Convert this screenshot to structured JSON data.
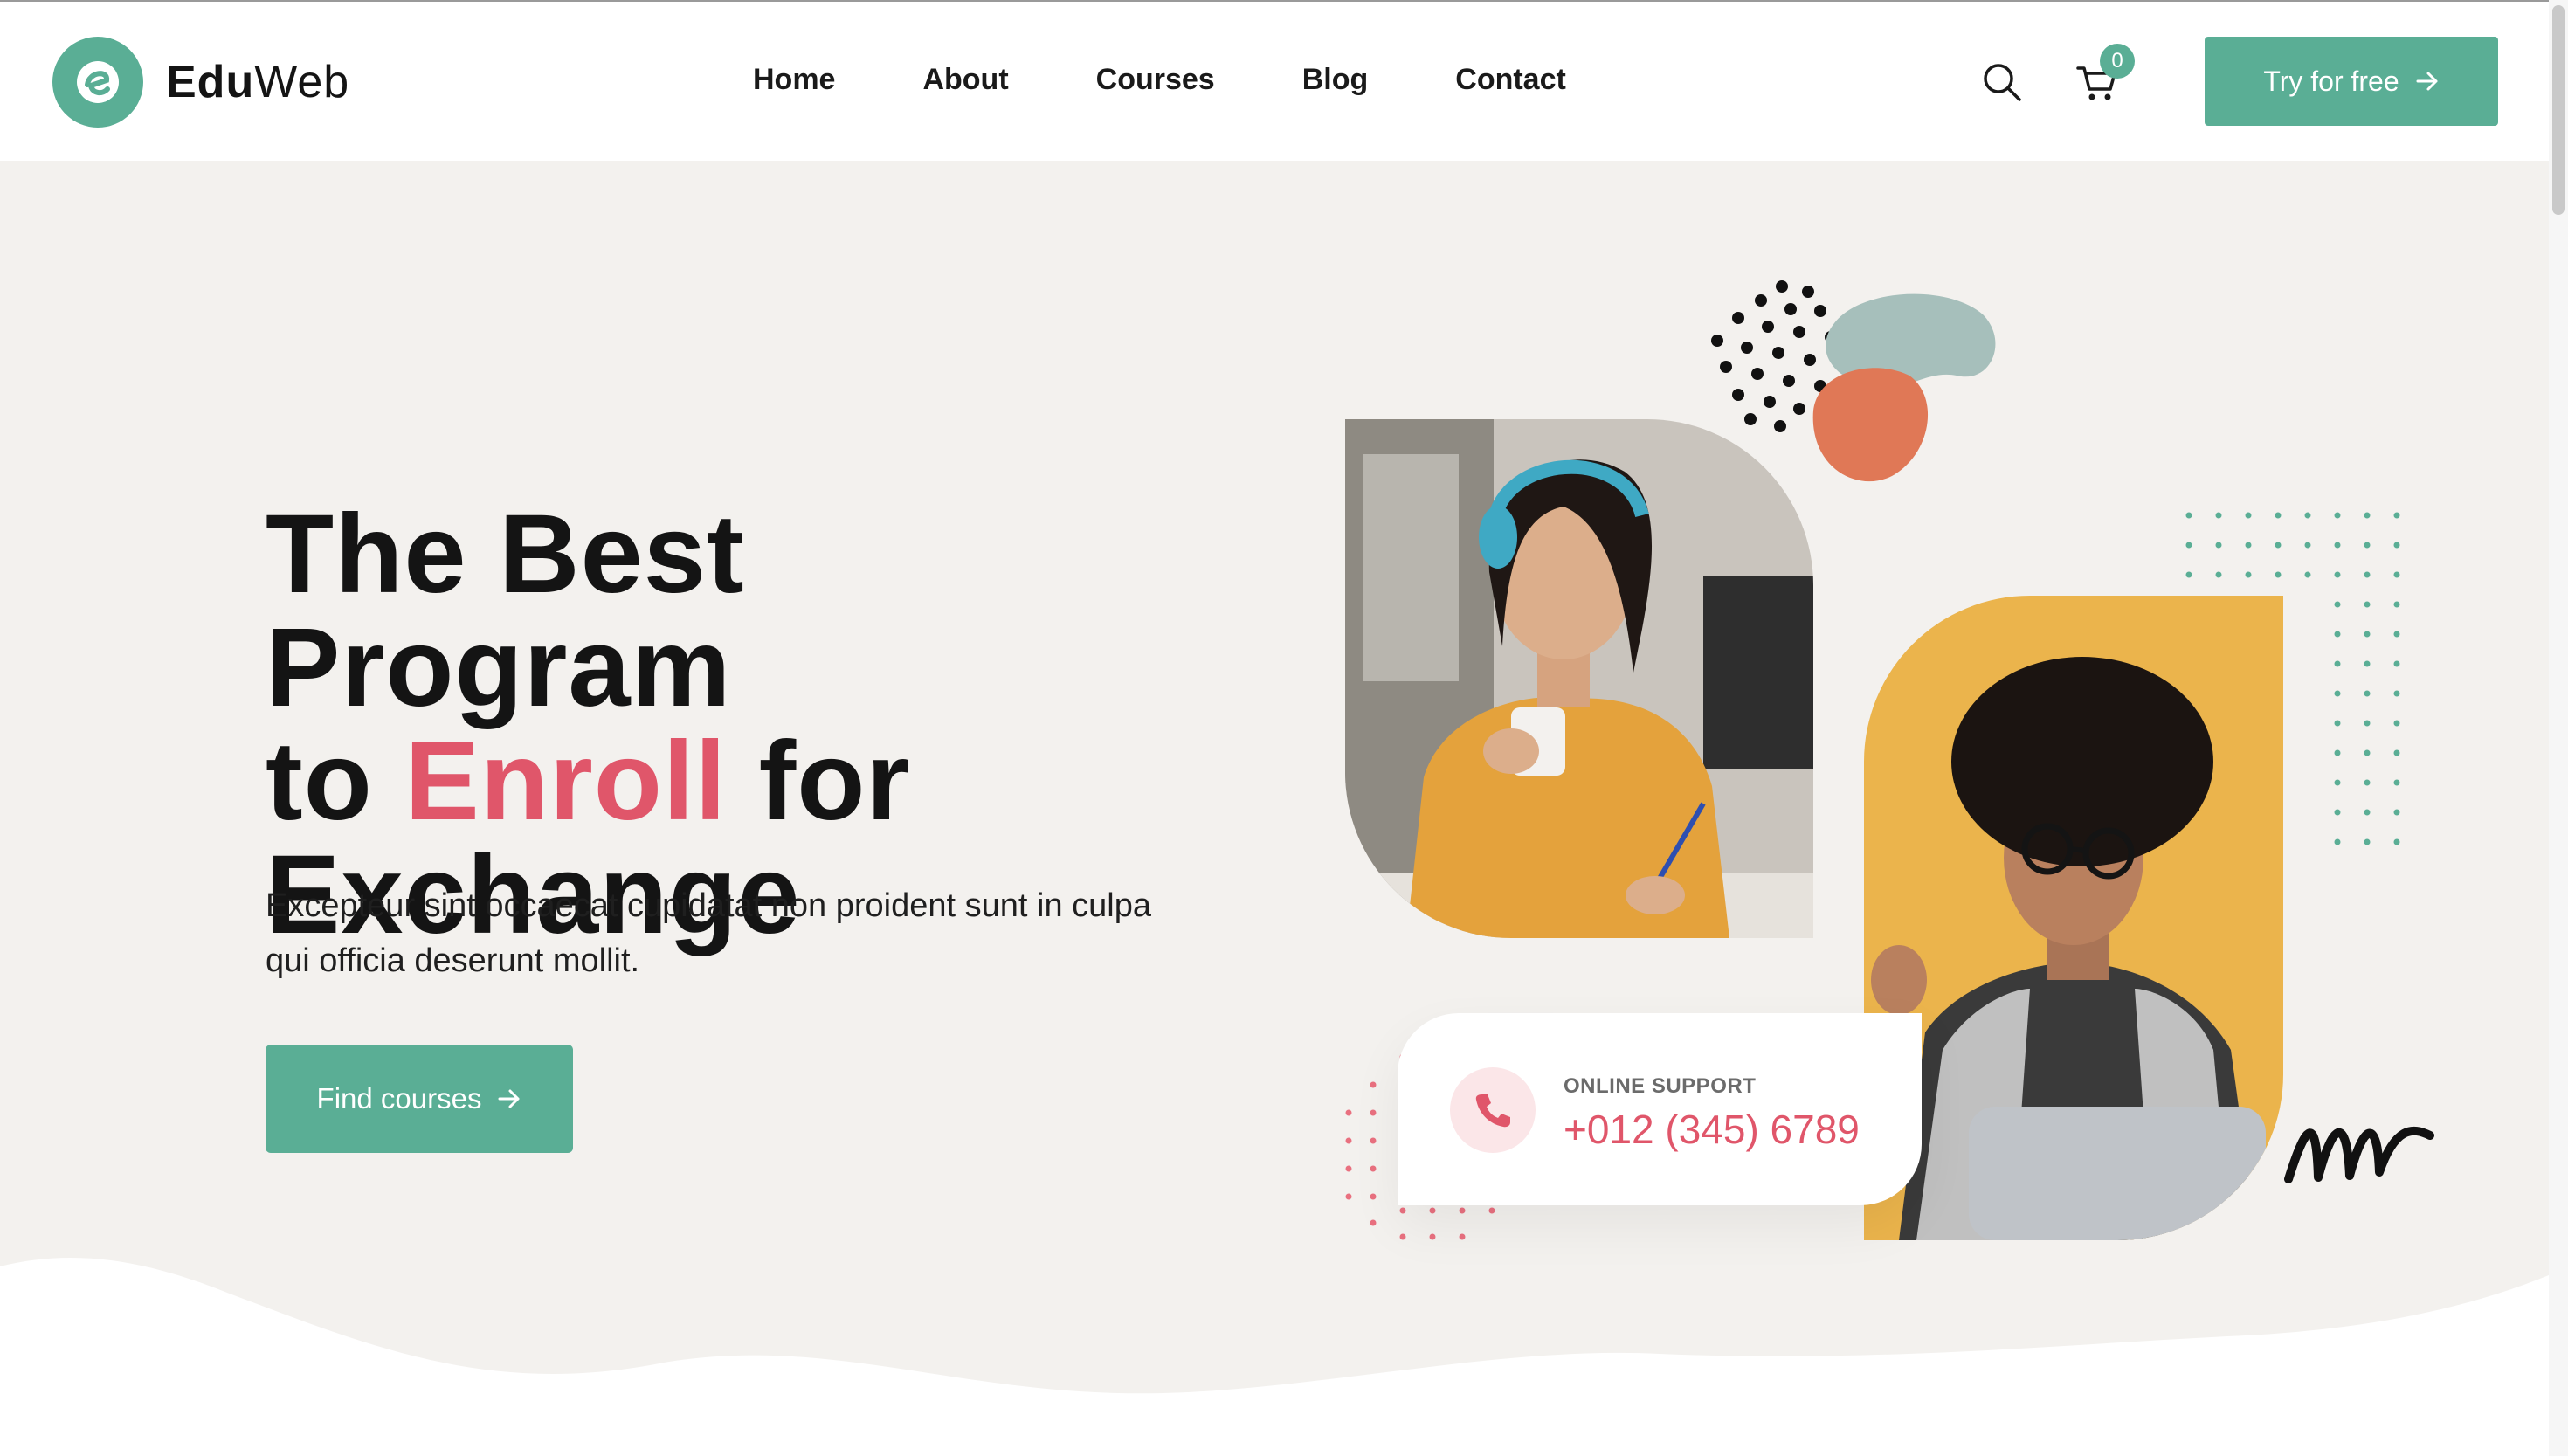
{
  "brand": {
    "name_bold": "Edu",
    "name_light": "Web",
    "accent_color": "#5aae95",
    "highlight_color": "#e0566a"
  },
  "nav": {
    "items": [
      {
        "label": "Home"
      },
      {
        "label": "About"
      },
      {
        "label": "Courses"
      },
      {
        "label": "Blog"
      },
      {
        "label": "Contact"
      }
    ]
  },
  "header": {
    "search_icon": "search-icon",
    "cart_icon": "cart-icon",
    "cart_count": "0",
    "cta_label": "Try for free"
  },
  "hero": {
    "title_line1": "The Best Program",
    "title_to": "to",
    "title_accent": "Enroll",
    "title_for": "for",
    "title_line3": "Exchange",
    "description": "Excepteur sint occaecat cupidatat non proident sunt in culpa qui officia deserunt mollit.",
    "cta_label": "Find courses"
  },
  "support": {
    "label": "ONLINE SUPPORT",
    "phone": "+012 (345) 6789",
    "icon": "phone-icon"
  }
}
